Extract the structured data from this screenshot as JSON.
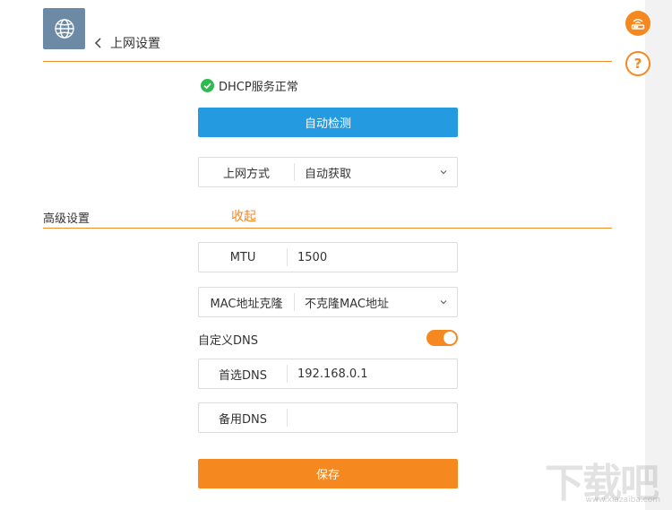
{
  "header": {
    "back_label": "上网设置"
  },
  "status": {
    "text": "DHCP服务正常",
    "color": "#2dbb4f"
  },
  "detect_button": {
    "label": "自动检测",
    "color": "#249be0"
  },
  "connection_type": {
    "label": "上网方式",
    "value": "自动获取"
  },
  "advanced": {
    "title": "高级设置",
    "collapse_label": "收起"
  },
  "mtu": {
    "label": "MTU",
    "value": "1500"
  },
  "mac_clone": {
    "label": "MAC地址克隆",
    "value": "不克隆MAC地址"
  },
  "custom_dns": {
    "label": "自定义DNS",
    "enabled": true
  },
  "primary_dns": {
    "label": "首选DNS",
    "value": "192.168.0.1"
  },
  "secondary_dns": {
    "label": "备用DNS",
    "value": ""
  },
  "save_button": {
    "label": "保存",
    "color": "#f5891f"
  },
  "side_icons": [
    "router-icon",
    "help-icon"
  ],
  "accent_color": "#f08c2e",
  "watermark": {
    "logo_text": "下载吧",
    "url": "www.xiazaiba.com"
  }
}
